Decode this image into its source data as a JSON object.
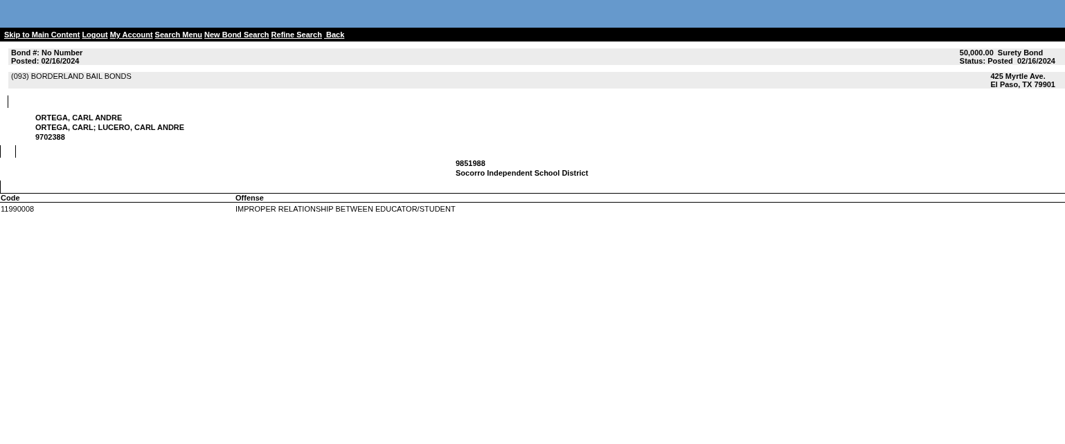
{
  "nav_links": [
    "Skip to Main Content",
    "Logout",
    "My Account",
    "Search Menu",
    "New Bond Search",
    "Refine Search",
    " Back"
  ],
  "bond": {
    "number": "Bond #: No Number",
    "posted": "Posted: 02/16/2024",
    "amount": "50,000.00  Surety Bond",
    "status": "Status: Posted  02/16/2024"
  },
  "surety": {
    "name": "(093) BORDERLAND BAIL BONDS",
    "address_line_1": "425 Myrtle Ave.",
    "address_line_2": "El Paso, TX 79901"
  },
  "defendant": {
    "name": "ORTEGA, CARL ANDRE",
    "aliases": "ORTEGA, CARL; LUCERO, CARL ANDRE",
    "id": "9702388"
  },
  "case": {
    "number": "9851988",
    "agency": "Socorro Independent School District"
  },
  "table": {
    "columns": [
      "Code",
      "Offense"
    ],
    "rows": [
      {
        "code": "11990008",
        "offense": "IMPROPER RELATIONSHIP BETWEEN EDUCATOR/STUDENT"
      }
    ]
  }
}
